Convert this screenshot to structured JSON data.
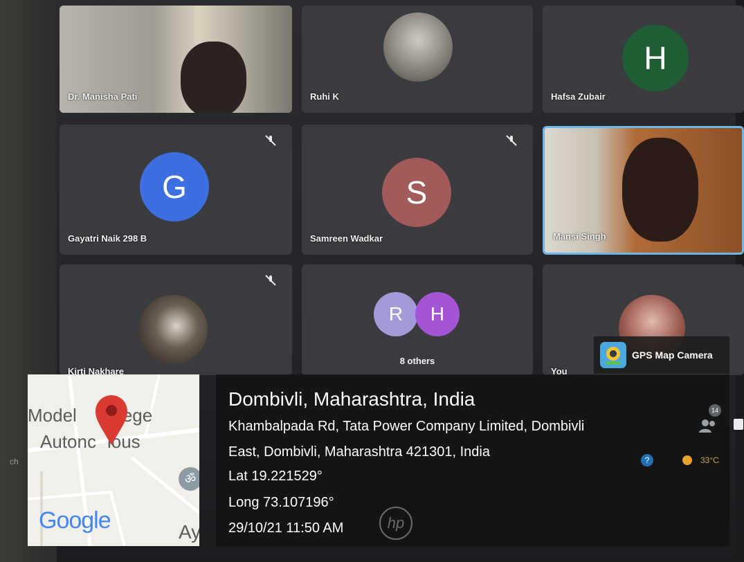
{
  "participants": [
    {
      "name": "Dr. Manisha Pati"
    },
    {
      "name": "Ruhi K"
    },
    {
      "name": "Hafsa Zubair",
      "initial": "H",
      "color": "#1f5e34"
    },
    {
      "name": "Gayatri Naik 298 B",
      "initial": "G",
      "color": "#3d6fe0"
    },
    {
      "name": "Samreen Wadkar",
      "initial": "S",
      "color": "#a25a5a"
    },
    {
      "name": "Mansi Singh"
    },
    {
      "name": "Kirti Nakhare"
    },
    {
      "name": "8 others",
      "initials": [
        "R",
        "H"
      ],
      "colors": [
        "#a39ad8",
        "#a355d6"
      ]
    },
    {
      "name": "You"
    }
  ],
  "gps_badge": {
    "label": "GPS Map Camera"
  },
  "location": {
    "title": "Dombivli, Maharashtra, India",
    "address_line1": "Khambalpada Rd, Tata Power Company Limited, Dombivli",
    "address_line2": "East, Dombivli, Maharashtra 421301, India",
    "lat": "Lat 19.221529°",
    "long": "Long 73.107196°",
    "datetime": "29/10/21 11:50 AM"
  },
  "map": {
    "label1": "Model",
    "label1b": "ege",
    "label2": "Autonc",
    "label2b": "ious",
    "label3": "Ay",
    "brand": "Google"
  },
  "meeting": {
    "participant_count": "14"
  },
  "taskbar": {
    "search_fragment": "ch",
    "temperature": "33°C"
  },
  "laptop_brand": "hp"
}
